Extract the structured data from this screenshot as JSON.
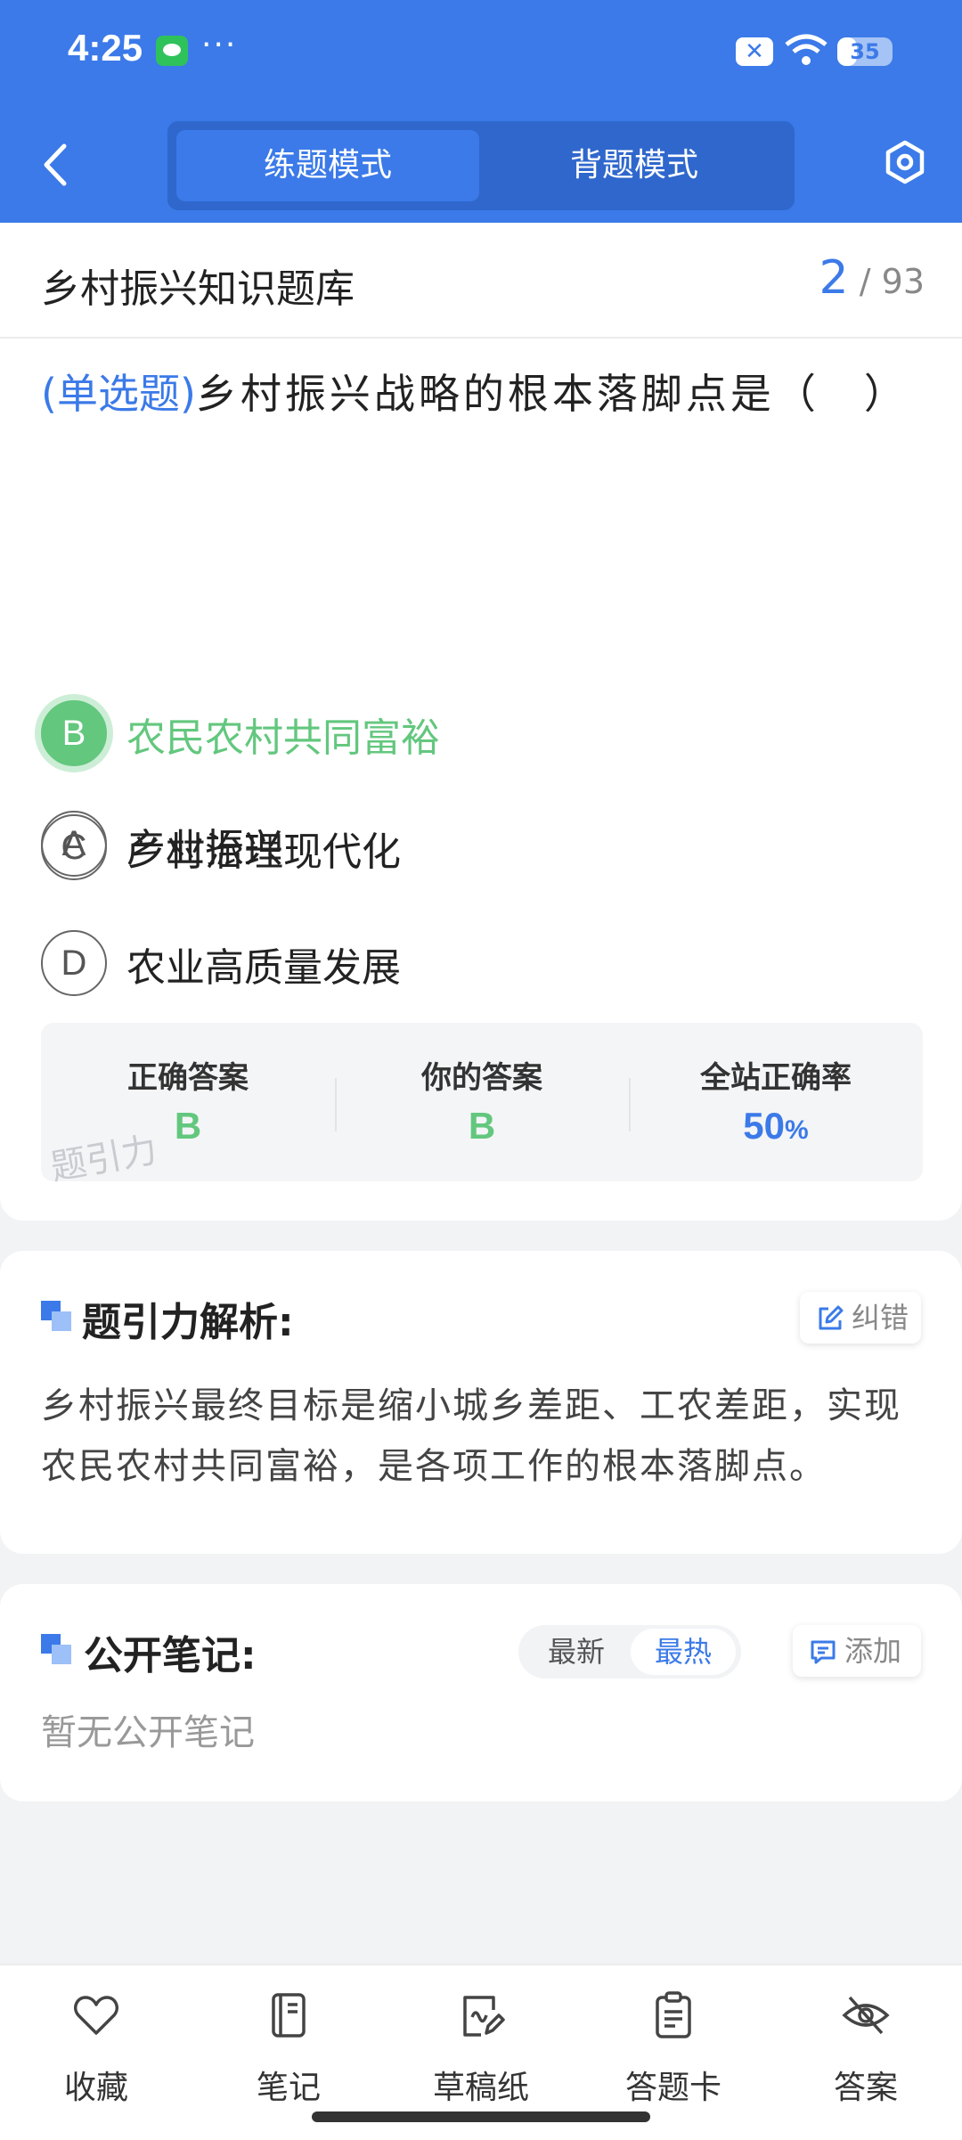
{
  "status_bar": {
    "time": "4:25",
    "dots": "···",
    "battery": "35",
    "battery_level": 0.35
  },
  "header": {
    "tabs": [
      {
        "label": "练题模式",
        "active": true
      },
      {
        "label": "背题模式",
        "active": false
      }
    ]
  },
  "bank": {
    "title": "乡村振兴知识题库",
    "current": "2",
    "separator": "/",
    "total": "93"
  },
  "question": {
    "type": "(单选题)",
    "text": "乡村振兴战略的根本落脚点是（　）"
  },
  "options": [
    {
      "letter": "A",
      "text": "产业振兴"
    },
    {
      "letter": "B",
      "text": "农民农村共同富裕"
    },
    {
      "letter": "C",
      "text": "乡村治理现代化"
    },
    {
      "letter": "D",
      "text": "农业高质量发展"
    }
  ],
  "result": {
    "correct_label": "正确答案",
    "correct_value": "B",
    "yours_label": "你的答案",
    "yours_value": "B",
    "rate_label": "全站正确率",
    "rate_value": "50",
    "rate_unit": "%",
    "watermark": "题引力",
    "colors": {
      "correct": "#63c77e",
      "rate": "#3b7ae8"
    }
  },
  "analysis": {
    "title": "题引力解析:",
    "fix_label": "纠错",
    "text": "乡村振兴最终目标是缩小城乡差距、工农差距，实现农民农村共同富裕，是各项工作的根本落脚点。"
  },
  "notes": {
    "title": "公开笔记:",
    "sort_latest": "最新",
    "sort_hot": "最热",
    "add_label": "添加",
    "empty": "暂无公开笔记"
  },
  "bottom_nav": [
    {
      "label": "收藏",
      "icon": "heart-icon"
    },
    {
      "label": "笔记",
      "icon": "notebook-icon"
    },
    {
      "label": "草稿纸",
      "icon": "draft-paper-icon"
    },
    {
      "label": "答题卡",
      "icon": "answer-sheet-icon"
    },
    {
      "label": "答案",
      "icon": "eye-off-icon"
    }
  ],
  "colors": {
    "brand": "#3b7ae8",
    "correct": "#63c77e",
    "background": "#f2f3f5"
  }
}
